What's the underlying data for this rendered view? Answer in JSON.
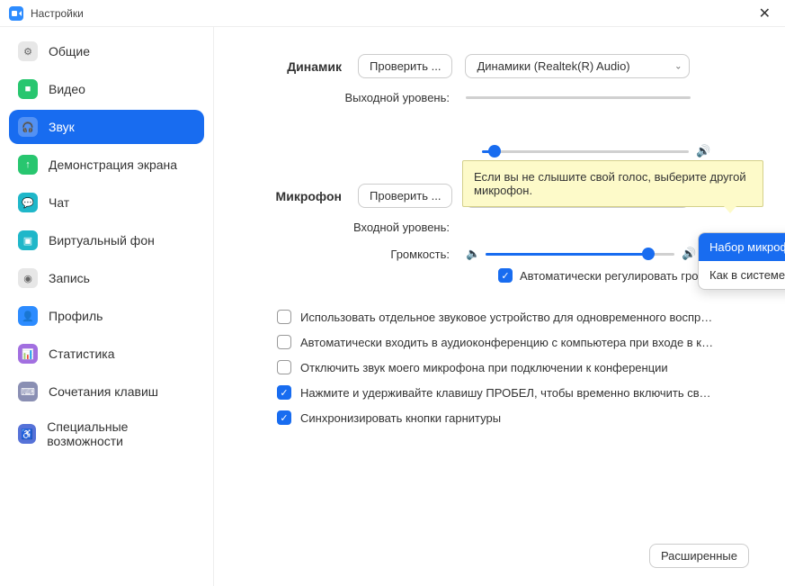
{
  "window": {
    "title": "Настройки"
  },
  "sidebar": {
    "items": [
      {
        "label": "Общие",
        "icon": "gear",
        "bg": "#e7e7e7",
        "glyph": "⚙"
      },
      {
        "label": "Видео",
        "icon": "video",
        "bg": "#28c66f",
        "glyph": "■"
      },
      {
        "label": "Звук",
        "icon": "audio",
        "bg": "#fff",
        "glyph": "🎧",
        "active": true
      },
      {
        "label": "Демонстрация экрана",
        "icon": "share",
        "bg": "#28c66f",
        "glyph": "↑"
      },
      {
        "label": "Чат",
        "icon": "chat",
        "bg": "#1fb7c9",
        "glyph": "💬"
      },
      {
        "label": "Виртуальный фон",
        "icon": "virtual-bg",
        "bg": "#1fb7c9",
        "glyph": "▣"
      },
      {
        "label": "Запись",
        "icon": "record",
        "bg": "#e7e7e7",
        "glyph": "◉"
      },
      {
        "label": "Профиль",
        "icon": "profile",
        "bg": "#2D8CFF",
        "glyph": "👤"
      },
      {
        "label": "Статистика",
        "icon": "stats",
        "bg": "#a26fe0",
        "glyph": "📊"
      },
      {
        "label": "Сочетания клавиш",
        "icon": "keyboard",
        "bg": "#8a8fb3",
        "glyph": "⌨"
      },
      {
        "label": "Специальные возможности",
        "icon": "accessibility",
        "bg": "#5672d8",
        "glyph": "♿"
      }
    ]
  },
  "speaker": {
    "label": "Динамик",
    "test_btn": "Проверить ...",
    "device": "Динамики (Realtek(R) Audio)",
    "output_label": "Выходной уровень:"
  },
  "tooltip": "Если вы не слышите свой голос, выберите другой микрофон.",
  "mic": {
    "label": "Микрофон",
    "test_btn": "Проверить ...",
    "device": "Набор микрофонов (Realtek(R) ...",
    "input_label": "Входной уровень:",
    "volume_label": "Громкость:",
    "options": [
      "Набор микрофонов (Realtek(R) Audio)",
      "Как в системе"
    ],
    "auto_adjust": "Автоматически регулировать гром..."
  },
  "checkboxes": [
    {
      "label": "Использовать отдельное звуковое устройство для одновременного воспро...",
      "checked": false
    },
    {
      "label": "Автоматически входить в аудиоконференцию с компьютера при входе в кон...",
      "checked": false
    },
    {
      "label": "Отключить звук моего микрофона при подключении к конференции",
      "checked": false
    },
    {
      "label": "Нажмите и удерживайте клавишу ПРОБЕЛ, чтобы временно включить свой з...",
      "checked": true
    },
    {
      "label": "Синхронизировать кнопки гарнитуры",
      "checked": true
    }
  ],
  "advanced_btn": "Расширенные"
}
